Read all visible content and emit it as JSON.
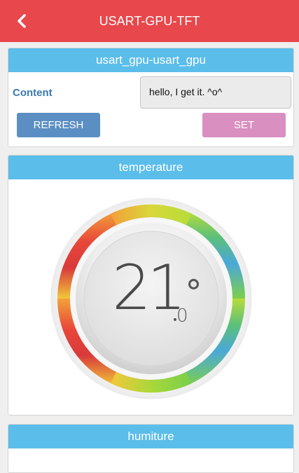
{
  "header": {
    "title": "USART-GPU-TFT",
    "back_icon": "chevron-left-icon"
  },
  "device_card": {
    "title": "usart_gpu-usart_gpu",
    "content_label": "Content",
    "content_value": "hello, I get it. ^o^",
    "refresh_label": "REFRESH",
    "set_label": "SET"
  },
  "temperature_card": {
    "title": "temperature",
    "value_integer": "21",
    "value_decimal": "0",
    "unit_symbol": "°"
  },
  "humiture_card": {
    "title": "humiture"
  },
  "colors": {
    "accent_red": "#e8474b",
    "header_blue": "#5bbdea",
    "refresh_blue": "#5b8fc3",
    "set_pink": "#d98fc0",
    "label_blue": "#3a79b0"
  }
}
